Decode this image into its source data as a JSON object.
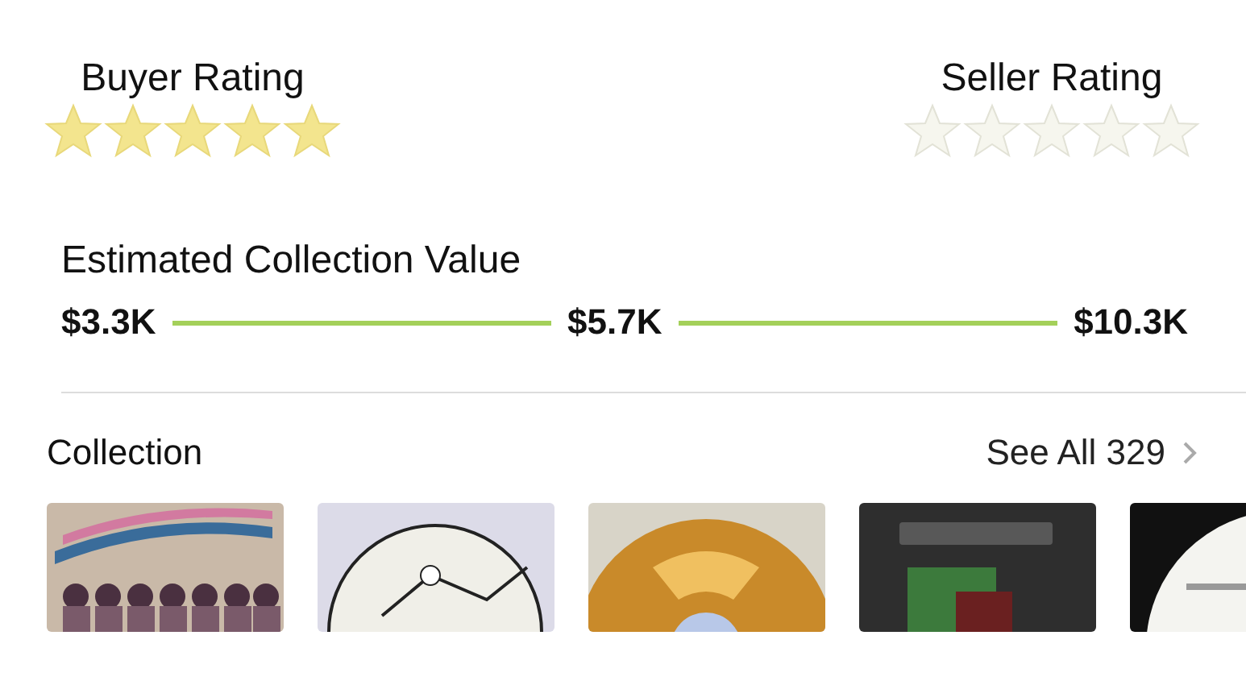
{
  "ratings": [
    {
      "label": "Buyer Rating",
      "stars": 5
    },
    {
      "label": "Seller Rating",
      "stars": 0
    }
  ],
  "collection_value": {
    "title": "Estimated Collection Value",
    "low": "$3.3K",
    "median": "$5.7K",
    "high": "$10.3K"
  },
  "collection": {
    "title": "Collection",
    "see_all": "See All 329"
  }
}
